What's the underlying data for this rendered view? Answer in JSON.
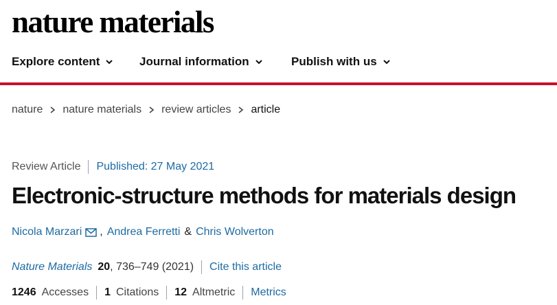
{
  "header": {
    "logo": "nature materials"
  },
  "nav": {
    "items": [
      {
        "label": "Explore content"
      },
      {
        "label": "Journal information"
      },
      {
        "label": "Publish with us"
      }
    ]
  },
  "breadcrumb": {
    "items": [
      "nature",
      "nature materials",
      "review articles",
      "article"
    ]
  },
  "article": {
    "type": "Review Article",
    "published": "Published: 27 May 2021",
    "title": "Electronic-structure methods for materials design",
    "authors": [
      "Nicola Marzari",
      "Andrea Ferretti",
      "Chris Wolverton"
    ],
    "author_separator": ",",
    "author_amp": "&",
    "journal": "Nature Materials",
    "volume": "20",
    "pages": ", 736–749 (2021)",
    "cite_label": "Cite this article"
  },
  "metrics": {
    "accesses_value": "1246",
    "accesses_label": "Accesses",
    "citations_value": "1",
    "citations_label": "Citations",
    "altmetric_value": "12",
    "altmetric_label": "Altmetric",
    "metrics_link": "Metrics"
  },
  "colors": {
    "accent_red": "#c8102e",
    "link_blue": "#1d6aa3"
  }
}
